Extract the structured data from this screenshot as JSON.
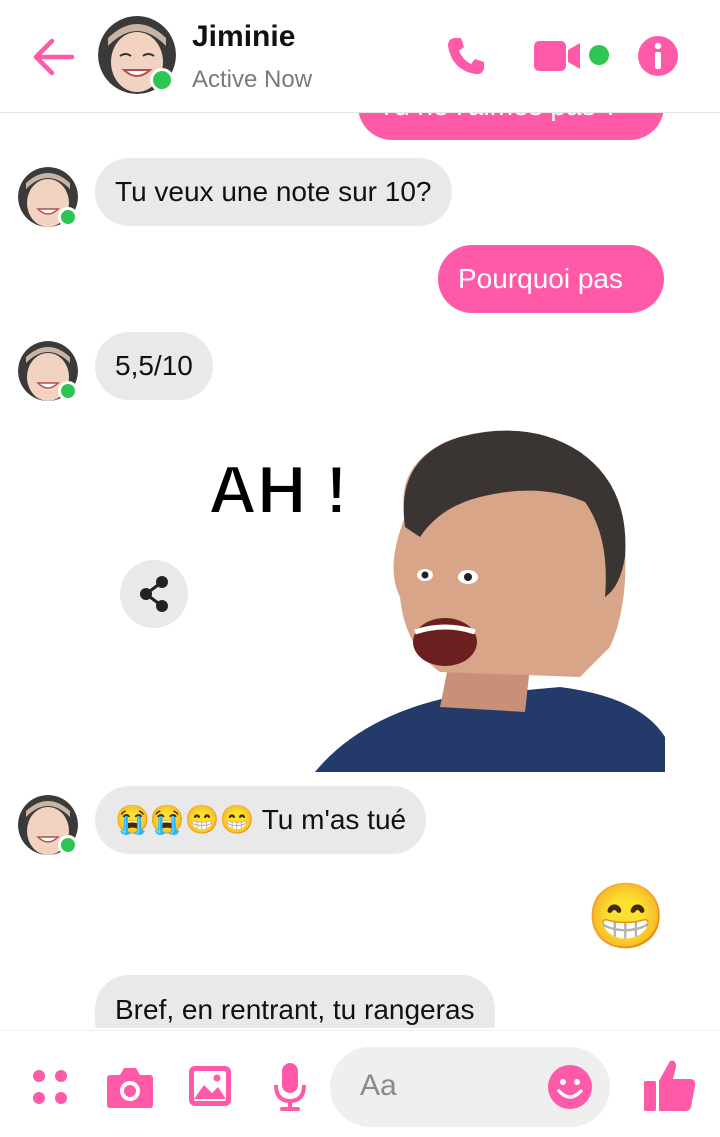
{
  "colors": {
    "accent": "#fe5aa8",
    "online": "#2dc653",
    "incoming_bg": "#e9e9e9"
  },
  "header": {
    "name": "Jiminie",
    "status": "Active Now",
    "icons": [
      "back-arrow-icon",
      "phone-icon",
      "video-camera-icon",
      "info-icon"
    ]
  },
  "messages": [
    {
      "from": "me",
      "text": "Tu ne l'aimes pas ?"
    },
    {
      "from": "them",
      "text": "Tu veux une note sur 10?"
    },
    {
      "from": "me",
      "text": "Pourquoi pas"
    },
    {
      "from": "them",
      "text": "5,5/10"
    },
    {
      "from": "them",
      "sticker_caption": "AH !"
    },
    {
      "from": "them",
      "emoji": "😭😭😁😁",
      "text": "Tu m'as tué"
    },
    {
      "from": "me",
      "emoji": "😁"
    },
    {
      "from": "them",
      "text": "Bref, en rentrant, tu rangeras"
    }
  ],
  "composer": {
    "placeholder": "Aa",
    "icons": [
      "apps-grid-icon",
      "camera-icon",
      "gallery-icon",
      "microphone-icon",
      "emoji-icon",
      "like-icon"
    ]
  }
}
